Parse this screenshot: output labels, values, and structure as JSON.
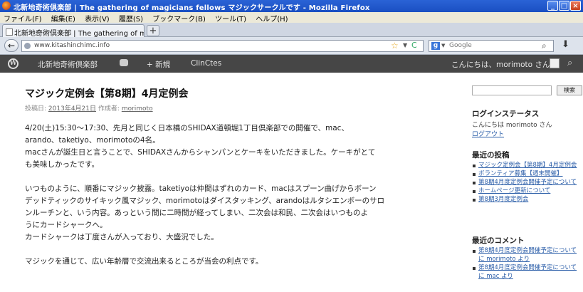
{
  "window": {
    "title": "北新地奇術倶楽部 | The gathering of magicians fellows マジックサークルです - Mozilla Firefox",
    "min_label": "_",
    "max_label": "□",
    "close_label": "×"
  },
  "menu": [
    "ファイル(F)",
    "編集(E)",
    "表示(V)",
    "履歴(S)",
    "ブックマーク(B)",
    "ツール(T)",
    "ヘルプ(H)"
  ],
  "tab": {
    "label": "北新地奇術倶楽部 | The gathering of mag...",
    "new_tab_label": "+"
  },
  "nav": {
    "back_label": "←",
    "url": "www.kitashinchimc.info",
    "star": "☆",
    "dropdown": "▼",
    "reload": "C",
    "search_engine": "g",
    "search_dropdown": "▼",
    "search_placeholder": "Google",
    "search_icon": "⌕",
    "download_icon": "⬇"
  },
  "wpbar": {
    "logo": "W",
    "site_name": "北新地奇術倶楽部",
    "new_label": "新規",
    "cache_label": "ClinCtes",
    "howdy": "こんにちは、morimoto さん！"
  },
  "post": {
    "title": "マジック定例会【第8期】4月定例会",
    "meta_prefix": "投稿日:",
    "date": "2013年4月21日",
    "author_prefix": "作成者:",
    "author": "morimoto",
    "paragraphs": [
      "4/20(土)15:30〜17:30、先月と同じく日本橋のSHIDAX道頓堀1丁目倶楽部での開催で、mac、",
      "arando、taketiyo、morimotoの4名。",
      "macさんが誕生日と言うことで、SHIDAXさんからシャンパンとケーキをいただきました。ケーキがとて",
      "も美味しかったです。",
      "",
      "いつものように、順番にマジック披露。taketiyoは仲間はずれのカード、macはスプーン曲げからボーン",
      "デッドティックのサイキック風マジック、morimotoはダイスタッキング、arandoはルタシエンボーのサロ",
      "ンルーチンと、いう内容。あっという間に二時間が経ってしまい、二次会は和民、二次会はいつものよ",
      "うにカードシャークへ。",
      "カードシャークは丁度さんが入っており、大盛況でした。",
      "",
      "マジックを通じて、広い年齢層で交流出来るところが当会の利点です。"
    ]
  },
  "sidebar": {
    "search_button": "検索",
    "login_heading": "ログインステータス",
    "login_text": "こんにちは morimoto さん",
    "logout": "ログアウト",
    "recent_posts_heading": "最近の投稿",
    "recent_posts": [
      "マジック定例会【第8期】4月定例会",
      "ボランティア募集【週末開催】",
      "第8期4月度定例会開催予定について",
      "ホームページ更新について",
      "第8期3月度定例会"
    ],
    "recent_comments_heading": "最近のコメント",
    "recent_comments": [
      {
        "link": "第8期4月度定例会開催予定について",
        "by": "に morimoto より"
      },
      {
        "link": "第8期4月度定例会開催予定について",
        "by": "に mac より"
      }
    ]
  }
}
